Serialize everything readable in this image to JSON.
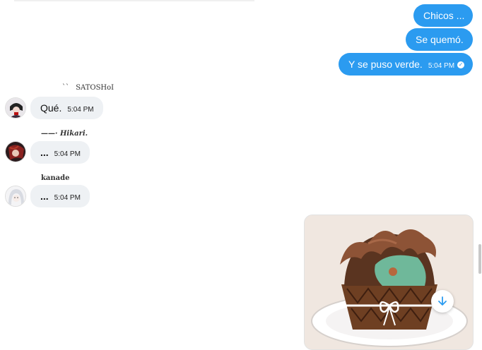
{
  "outgoing": [
    {
      "text": "Chicos ...",
      "time": ""
    },
    {
      "text": "Se quemó.",
      "time": ""
    },
    {
      "text": "Y se puso verde.",
      "time": "5:04 PM"
    }
  ],
  "incoming": [
    {
      "sender": "SATOSHoI",
      "sender_prefix": "``",
      "text": "Qué.",
      "time": "5:04 PM",
      "avatar_icon": "user-avatar-satoshi"
    },
    {
      "sender": "——· Hikari.",
      "text": "...",
      "time": "5:04 PM",
      "avatar_icon": "user-avatar-hikari"
    },
    {
      "sender": "kanade",
      "text": "...",
      "time": "5:04 PM",
      "avatar_icon": "user-avatar-kanade"
    }
  ],
  "image_message": {
    "icon": "cupcake-image"
  },
  "scroll_button": {
    "icon": "arrow-down-icon"
  },
  "colors": {
    "outgoing_bubble": "#2b9bf0",
    "incoming_bubble": "#eef1f4",
    "accent": "#2b9bf0"
  }
}
